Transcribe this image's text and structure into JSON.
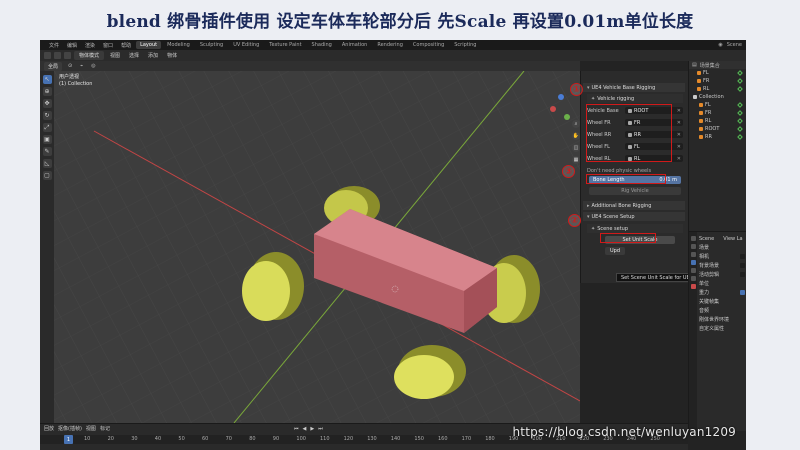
{
  "headline": "blend 绑骨插件使用 设定车体车轮部分后 先Scale 再设置0.01m单位长度",
  "menubar": {
    "menus": [
      "文件",
      "编辑",
      "渲染",
      "窗口",
      "帮助"
    ],
    "workspaces": [
      "Layout",
      "Modeling",
      "Sculpting",
      "UV Editing",
      "Texture Paint",
      "Shading",
      "Animation",
      "Rendering",
      "Compositing",
      "Scripting"
    ],
    "active_workspace": "Layout",
    "scene_label": "Scene"
  },
  "toolbar": {
    "mode": "物体模式",
    "menus": [
      "视图",
      "选择",
      "添加",
      "物体"
    ],
    "orientation": "全局"
  },
  "viewport": {
    "view_name": "用户透视",
    "collection": "(1) Collection"
  },
  "npanel": {
    "title": "UE4 Vehicle Base Rigging",
    "sub_section": "Vehicle rigging",
    "rows": [
      {
        "label": "Vehicle Base",
        "value": "ROOT"
      },
      {
        "label": "Wheel FR",
        "value": "FR"
      },
      {
        "label": "Wheel RR",
        "value": "RR"
      },
      {
        "label": "Wheel FL",
        "value": "FL"
      },
      {
        "label": "Wheel RL",
        "value": "RL"
      }
    ],
    "partial_text": "Don't need physic wheels",
    "bone_length_label": "Bone Length",
    "bone_length_value": "0.01 m",
    "rig_vehicle": "Rig Vehicle",
    "additional": "Additional Bone Rigging",
    "scene_setup_section": "UE4 Scene Setup",
    "scene_setup_sub": "Scene setup",
    "set_unit_scale": "Set Unit Scale",
    "partial_button": "Upd"
  },
  "tooltip": "Set Scene Unit Scale for UE4",
  "badges": [
    "①",
    "②",
    "③"
  ],
  "outliner": {
    "header": "场景集合",
    "items": [
      {
        "label": "FL",
        "color": "#e58a2a"
      },
      {
        "label": "FR",
        "color": "#e58a2a"
      },
      {
        "label": "RL",
        "color": "#e58a2a"
      },
      {
        "label": "Collection",
        "color": "#cccccc"
      },
      {
        "label": "FL",
        "color": "#e58a2a"
      },
      {
        "label": "FR",
        "color": "#e58a2a"
      },
      {
        "label": "RL",
        "color": "#e58a2a"
      },
      {
        "label": "ROOT",
        "color": "#e58a2a"
      },
      {
        "label": "RR",
        "color": "#e58a2a"
      }
    ]
  },
  "properties": {
    "header": "Scene",
    "view_layer": "View La",
    "rows": [
      "场景",
      "相机",
      "背景场景",
      "活动剪辑",
      "单位",
      "重力",
      "关键帧集",
      "音频",
      "刚体世界环境",
      "自定义属性"
    ]
  },
  "timeline": {
    "menus": [
      "回放",
      "抠像(插帧)",
      "视图",
      "标记"
    ],
    "current_frame": "1",
    "ticks": [
      "10",
      "20",
      "30",
      "40",
      "50",
      "60",
      "70",
      "80",
      "90",
      "100",
      "110",
      "120",
      "130",
      "140",
      "150",
      "160",
      "170",
      "180",
      "190",
      "200",
      "210",
      "220",
      "230",
      "240",
      "250"
    ]
  },
  "watermark": "https://blog.csdn.net/wenluyan1209",
  "colors": {
    "grid_bg": "#3d3d3d",
    "body_color": "#d7848c",
    "wheel_color": "#bfc23a",
    "accent": "#4772b3",
    "annotation_red": "#d11a1a"
  }
}
